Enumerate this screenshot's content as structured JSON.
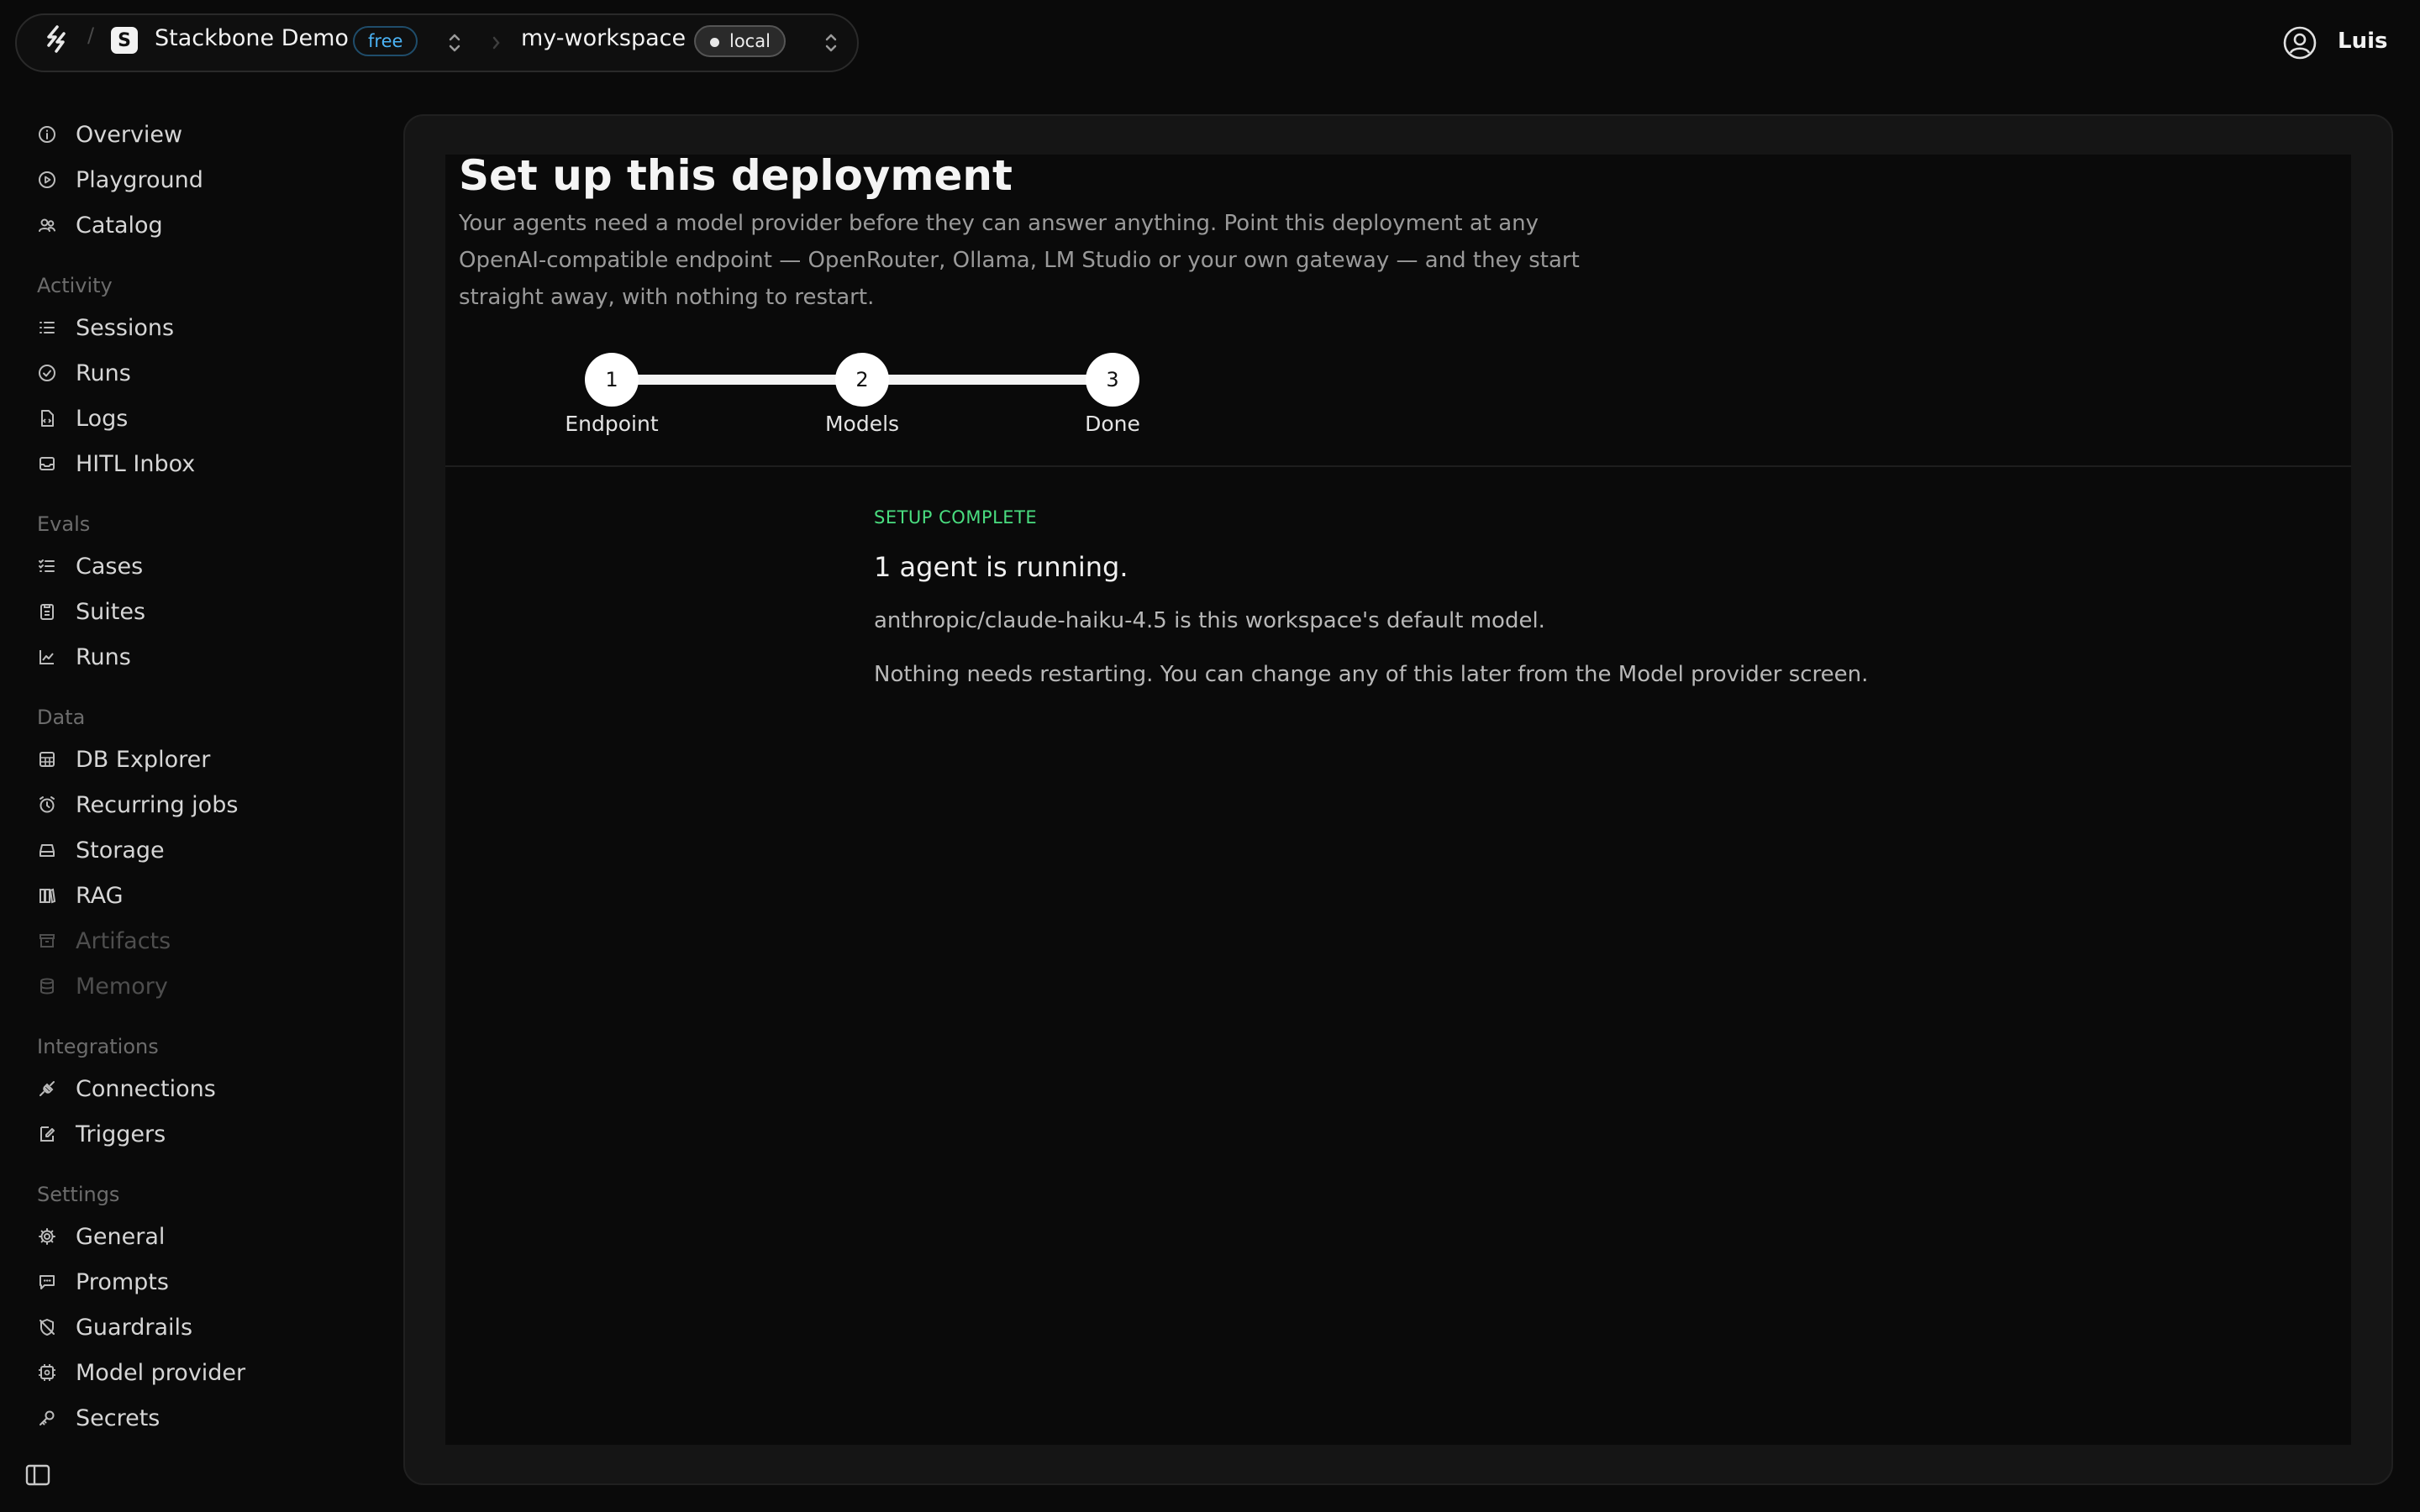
{
  "header": {
    "org_name": "Stackbone Demo",
    "org_initial": "S",
    "plan_badge": "free",
    "workspace_name": "my-workspace",
    "env_badge": "local",
    "user_name": "Luis"
  },
  "sidebar": {
    "top": [
      {
        "label": "Overview",
        "icon": "info-icon"
      },
      {
        "label": "Playground",
        "icon": "play-icon"
      },
      {
        "label": "Catalog",
        "icon": "users-icon"
      }
    ],
    "activity_label": "Activity",
    "activity": [
      {
        "label": "Sessions",
        "icon": "list-icon"
      },
      {
        "label": "Runs",
        "icon": "check-circle-icon"
      },
      {
        "label": "Logs",
        "icon": "file-icon"
      },
      {
        "label": "HITL Inbox",
        "icon": "inbox-icon"
      }
    ],
    "evals_label": "Evals",
    "evals": [
      {
        "label": "Cases",
        "icon": "checklist-icon"
      },
      {
        "label": "Suites",
        "icon": "clipboard-icon"
      },
      {
        "label": "Runs",
        "icon": "chart-line-icon"
      }
    ],
    "data_label": "Data",
    "data": [
      {
        "label": "DB Explorer",
        "icon": "table-icon"
      },
      {
        "label": "Recurring jobs",
        "icon": "alarm-icon"
      },
      {
        "label": "Storage",
        "icon": "storage-icon"
      },
      {
        "label": "RAG",
        "icon": "books-icon"
      },
      {
        "label": "Artifacts",
        "icon": "archive-icon"
      },
      {
        "label": "Memory",
        "icon": "database-icon"
      }
    ],
    "integrations_label": "Integrations",
    "integrations": [
      {
        "label": "Connections",
        "icon": "plug-icon"
      },
      {
        "label": "Triggers",
        "icon": "edit-icon"
      }
    ],
    "settings_label": "Settings",
    "settings": [
      {
        "label": "General",
        "icon": "gear-icon"
      },
      {
        "label": "Prompts",
        "icon": "message-icon"
      },
      {
        "label": "Guardrails",
        "icon": "shield-off-icon"
      },
      {
        "label": "Model provider",
        "icon": "cpu-gear-icon"
      },
      {
        "label": "Secrets",
        "icon": "key-icon"
      }
    ]
  },
  "main": {
    "title": "Set up this deployment",
    "description": "Your agents need a model provider before they can answer anything. Point this deployment at any OpenAI-compatible endpoint — OpenRouter, Ollama, LM Studio or your own gateway — and they start straight away, with nothing to restart.",
    "steps": [
      {
        "number": "1",
        "label": "Endpoint"
      },
      {
        "number": "2",
        "label": "Models"
      },
      {
        "number": "3",
        "label": "Done"
      }
    ],
    "status_label": "SETUP COMPLETE",
    "headline": "1 agent is running.",
    "model_line": "anthropic/claude-haiku-4.5 is this workspace's default model.",
    "note": "Nothing needs restarting. You can change any of this later from the Model provider screen."
  },
  "colors": {
    "background": "#0a0a0a",
    "panel": "#151515",
    "accent_green": "#4ade80",
    "accent_blue": "#4bb3f5"
  }
}
